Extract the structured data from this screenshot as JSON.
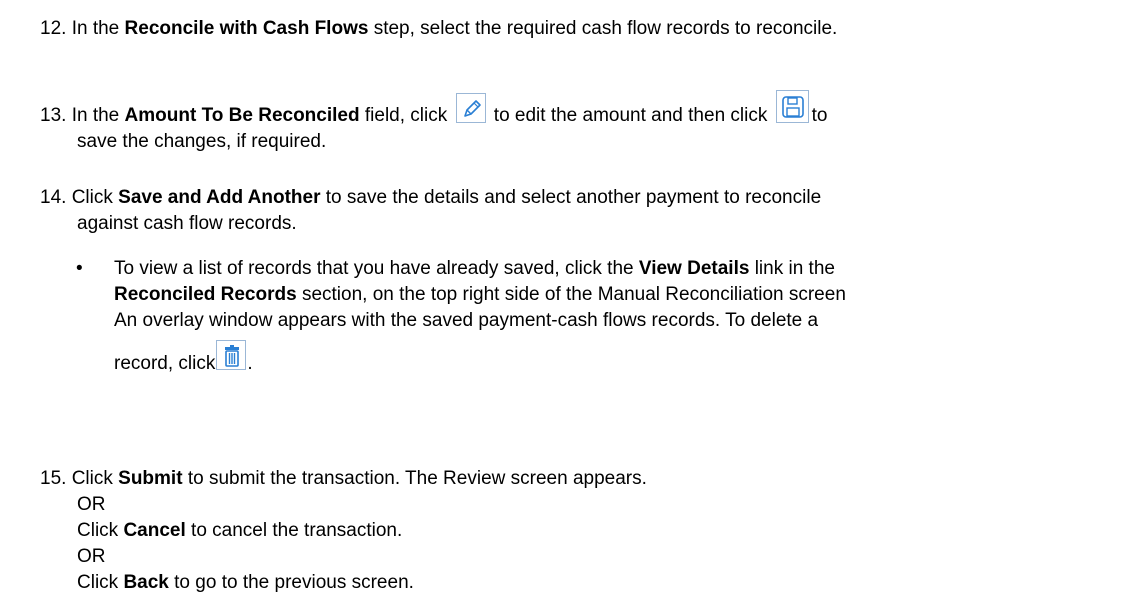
{
  "step12": {
    "number": "12.",
    "pre": "In the ",
    "bold": "Reconcile with Cash Flows",
    "post": " step, select the required cash flow records to reconcile."
  },
  "step13": {
    "number": "13.",
    "pre": "In the ",
    "bold": "Amount To Be Reconciled",
    "mid1": " field, click ",
    "mid2": " to edit the amount and then click ",
    "end1": "to",
    "line2": "save the changes, if required.",
    "icons": [
      "pencil-edit-icon",
      "save-disk-icon"
    ]
  },
  "step14": {
    "number": "14.",
    "pre": "Click ",
    "bold": "Save and Add Another",
    "post": " to save the details and select another payment to reconcile",
    "line2": "against cash flow records."
  },
  "bullet": {
    "symbol": "•",
    "pre": "To view a list of records that you have already saved, click the ",
    "bold1": "View Details",
    "mid": " link in the",
    "bold2": "Reconciled Records",
    "post2": " section, on the top right side of the Manual Reconciliation screen",
    "line3": "An overlay window appears with the saved payment-cash flows records. To delete a",
    "line4_pre": "record, click",
    "line4_post": ".",
    "icon": "trash-delete-icon"
  },
  "step15": {
    "number": "15.",
    "l1_pre": "Click ",
    "l1_bold": "Submit",
    "l1_post": " to submit the transaction. The Review screen appears.",
    "or1": "OR",
    "l2_pre": "Click ",
    "l2_bold": "Cancel",
    "l2_post": " to cancel the transaction.",
    "or2": "OR",
    "l3_pre": "Click ",
    "l3_bold": "Back",
    "l3_post": " to go to the previous screen."
  },
  "colors": {
    "icon_border": "#9bb7d6",
    "icon_blue": "#2a7fd4"
  }
}
